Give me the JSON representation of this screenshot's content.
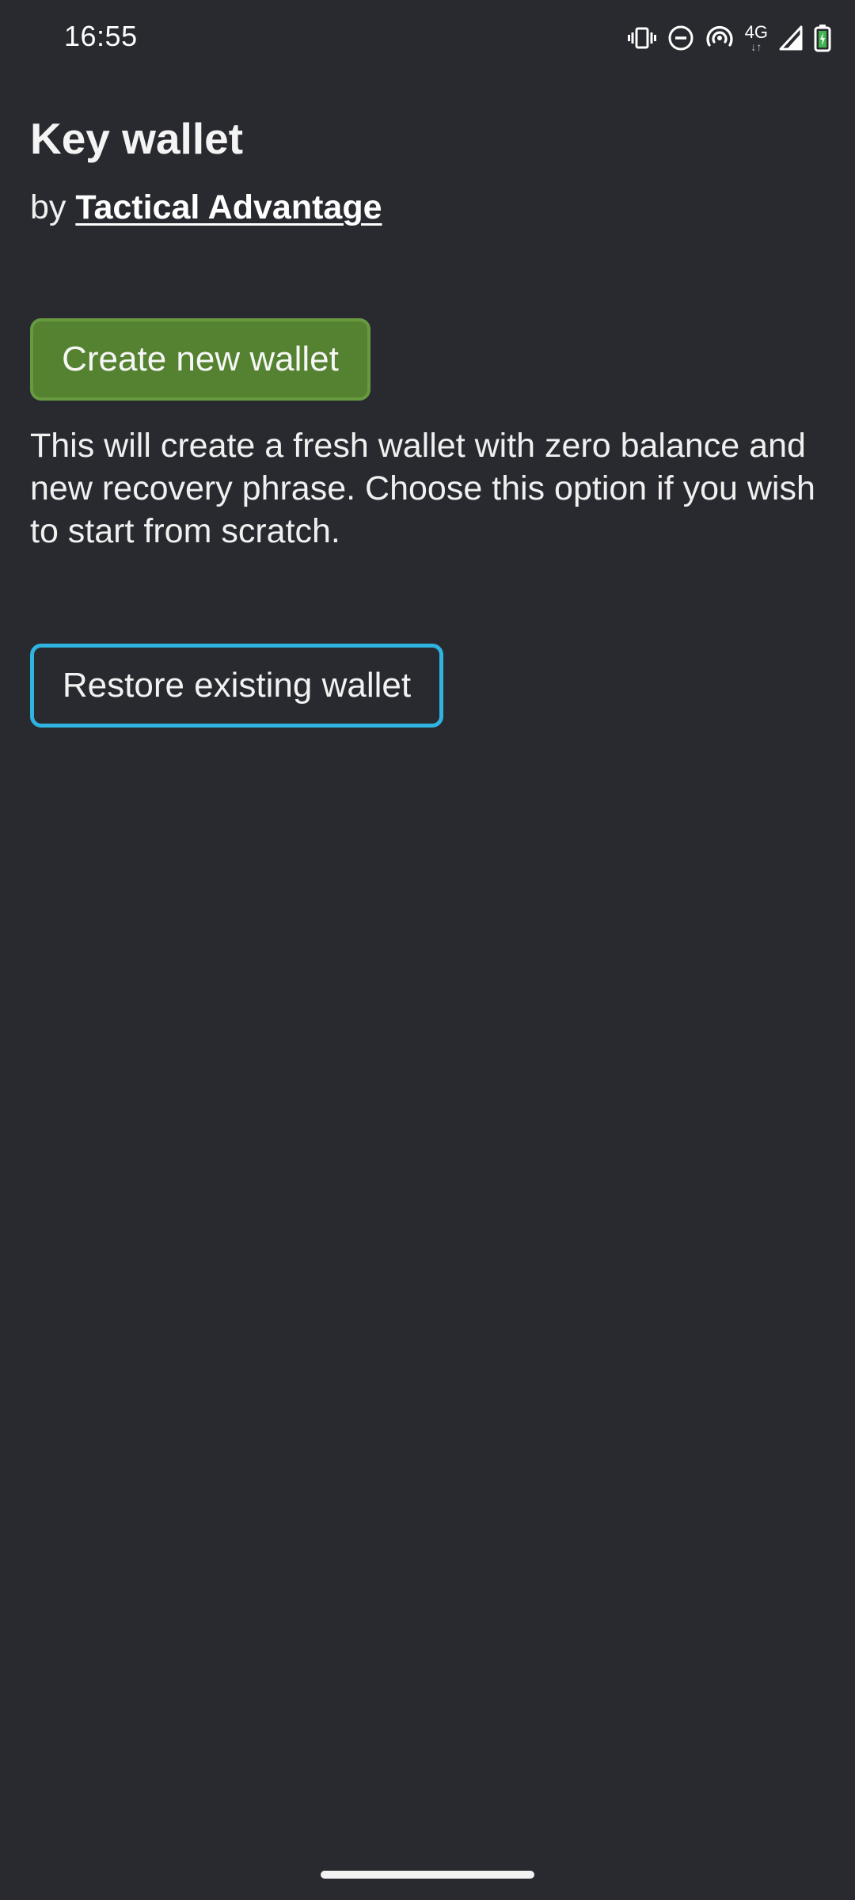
{
  "status_bar": {
    "time": "16:55",
    "network_type": "4G",
    "network_arrows": "↓↑",
    "icons": [
      "vibrate-icon",
      "do-not-disturb-icon",
      "hotspot-icon",
      "4g-icon",
      "signal-icon",
      "battery-charging-icon"
    ],
    "battery_accent": "#3fb34f"
  },
  "header": {
    "title": "Key wallet",
    "by_prefix": "by",
    "developer": "Tactical Advantage"
  },
  "actions": {
    "create_label": "Create new wallet",
    "create_description": "This will create a fresh wallet with zero balance and new recovery phrase. Choose this option if you wish to start from scratch.",
    "restore_label": "Restore existing wallet"
  },
  "colors": {
    "background": "#282a2f",
    "create_button": "#548230",
    "restore_border": "#2fb3e0"
  }
}
